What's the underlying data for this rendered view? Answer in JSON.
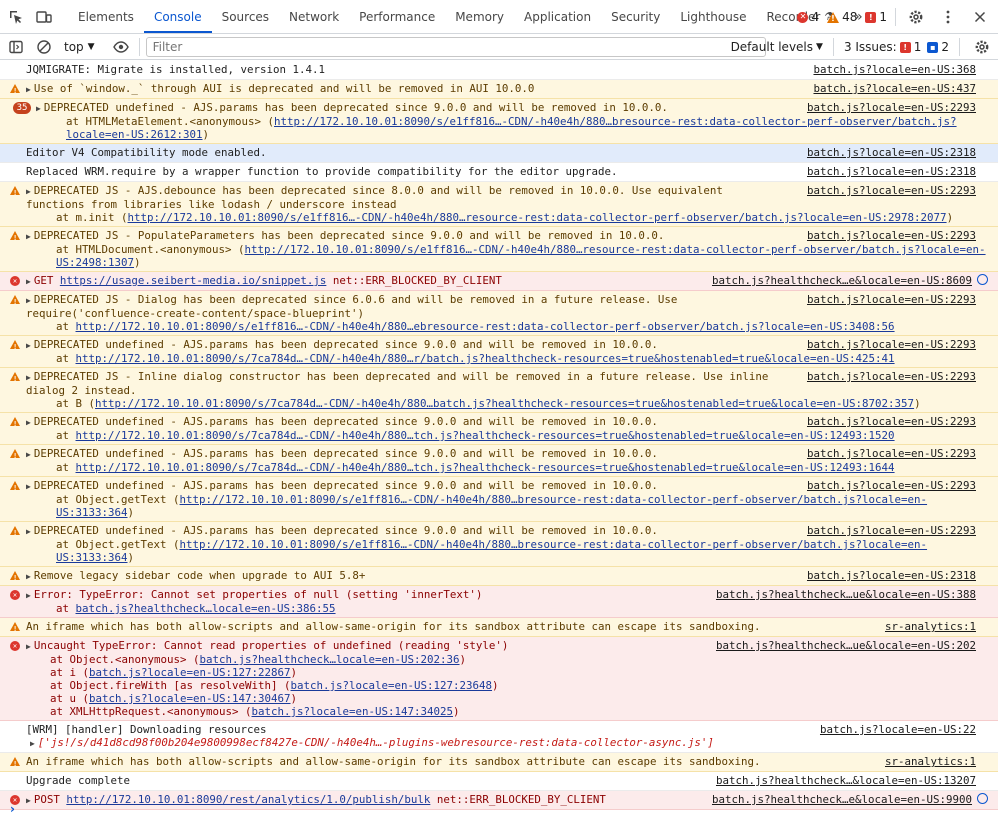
{
  "tabs": [
    "Elements",
    "Console",
    "Sources",
    "Network",
    "Performance",
    "Memory",
    "Application",
    "Security",
    "Lighthouse",
    "Recorder"
  ],
  "active_tab": "Console",
  "counts": {
    "errors": "4",
    "warnings": "48",
    "issues": "1"
  },
  "toolbar": {
    "context": "top",
    "filter_placeholder": "Filter",
    "levels": "Default levels",
    "issues_label": "3 Issues:",
    "issues_err": "1",
    "issues_info": "2"
  },
  "messages": [
    {
      "type": "log",
      "text": "JQMIGRATE: Migrate is installed, version 1.4.1",
      "src": "batch.js?locale=en-US:368"
    },
    {
      "type": "warn",
      "text": "Use of `window._` through AUI is deprecated and will be removed in AUI 10.0.0",
      "src": "batch.js?locale=en-US:437"
    },
    {
      "type": "warn",
      "badge": "35",
      "text": "DEPRECATED undefined - AJS.params has been deprecated since 9.0.0 and will be removed in 10.0.0.",
      "src": "batch.js?locale=en-US:2293",
      "trace": "at HTMLMetaElement.<anonymous> (",
      "link": "http://172.10.10.01:8090/s/e1ff816…-CDN/-h40e4h/880…bresource-rest:data-collector-perf-observer/batch.js?locale=en-US:2612:301",
      ")": ")"
    },
    {
      "type": "info",
      "text": "Editor V4 Compatibility mode enabled.",
      "src": "batch.js?locale=en-US:2318"
    },
    {
      "type": "log",
      "text": "Replaced WRM.require by a wrapper function to provide compatibility for the editor upgrade.",
      "src": "batch.js?locale=en-US:2318"
    },
    {
      "type": "warn",
      "text": "DEPRECATED JS - AJS.debounce has been deprecated since 8.0.0 and will be removed in 10.0.0. Use equivalent functions from libraries like lodash / underscore instead",
      "src": "batch.js?locale=en-US:2293",
      "trace": "at m.init (",
      "link": "http://172.10.10.01:8090/s/e1ff816…-CDN/-h40e4h/880…resource-rest:data-collector-perf-observer/batch.js?locale=en-US:2978:2077"
    },
    {
      "type": "warn",
      "text": "DEPRECATED JS - PopulateParameters has been deprecated since 9.0.0 and will be removed in 10.0.0.",
      "src": "batch.js?locale=en-US:2293",
      "trace": "at HTMLDocument.<anonymous> (",
      "link": "http://172.10.10.01:8090/s/e1ff816…-CDN/-h40e4h/880…resource-rest:data-collector-perf-observer/batch.js?locale=en-US:2498:1307"
    },
    {
      "type": "err",
      "pre": "GET ",
      "link": "https://usage.seibert-media.io/snippet.js",
      "post": " net::ERR_BLOCKED_BY_CLIENT",
      "src": "batch.js?healthcheck…e&locale=en-US:8609"
    },
    {
      "type": "warn",
      "text": "DEPRECATED JS - Dialog has been deprecated since 6.0.6 and will be removed in a future release. Use require('confluence-create-content/space-blueprint')",
      "src": "batch.js?locale=en-US:2293",
      "trace": "at ",
      "link": "http://172.10.10.01:8090/s/e1ff816…-CDN/-h40e4h/880…ebresource-rest:data-collector-perf-observer/batch.js?locale=en-US:3408:56"
    },
    {
      "type": "warn",
      "text": "DEPRECATED undefined - AJS.params has been deprecated since 9.0.0 and will be removed in 10.0.0.",
      "src": "batch.js?locale=en-US:2293",
      "trace": "at ",
      "link": "http://172.10.10.01:8090/s/7ca784d…-CDN/-h40e4h/880…r/batch.js?healthcheck-resources=true&hostenabled=true&locale=en-US:425:41"
    },
    {
      "type": "warn",
      "text": "DEPRECATED JS - Inline dialog constructor has been deprecated and will be removed in a future release. Use inline dialog 2 instead.",
      "src": "batch.js?locale=en-US:2293",
      "trace": "at B (",
      "link": "http://172.10.10.01:8090/s/7ca784d…-CDN/-h40e4h/880…batch.js?healthcheck-resources=true&hostenabled=true&locale=en-US:8702:357"
    },
    {
      "type": "warn",
      "text": "DEPRECATED undefined - AJS.params has been deprecated since 9.0.0 and will be removed in 10.0.0.",
      "src": "batch.js?locale=en-US:2293",
      "trace": "at ",
      "link": "http://172.10.10.01:8090/s/7ca784d…-CDN/-h40e4h/880…tch.js?healthcheck-resources=true&hostenabled=true&locale=en-US:12493:1520"
    },
    {
      "type": "warn",
      "text": "DEPRECATED undefined - AJS.params has been deprecated since 9.0.0 and will be removed in 10.0.0.",
      "src": "batch.js?locale=en-US:2293",
      "trace": "at ",
      "link": "http://172.10.10.01:8090/s/7ca784d…-CDN/-h40e4h/880…tch.js?healthcheck-resources=true&hostenabled=true&locale=en-US:12493:1644"
    },
    {
      "type": "warn",
      "text": "DEPRECATED undefined - AJS.params has been deprecated since 9.0.0 and will be removed in 10.0.0.",
      "src": "batch.js?locale=en-US:2293",
      "trace": "at Object.getText (",
      "link": "http://172.10.10.01:8090/s/e1ff816…-CDN/-h40e4h/880…bresource-rest:data-collector-perf-observer/batch.js?locale=en-US:3133:364"
    },
    {
      "type": "warn",
      "text": "DEPRECATED undefined - AJS.params has been deprecated since 9.0.0 and will be removed in 10.0.0.",
      "src": "batch.js?locale=en-US:2293",
      "trace": "at Object.getText (",
      "link": "http://172.10.10.01:8090/s/e1ff816…-CDN/-h40e4h/880…bresource-rest:data-collector-perf-observer/batch.js?locale=en-US:3133:364"
    },
    {
      "type": "warn",
      "text": "Remove legacy sidebar code when upgrade to AUI 5.8+",
      "src": "batch.js?locale=en-US:2318"
    },
    {
      "type": "err",
      "text": "Error: TypeError: Cannot set properties of null (setting 'innerText')",
      "src": "batch.js?healthcheck…ue&locale=en-US:388",
      "trace": "at ",
      "link": "batch.js?healthcheck…locale=en-US:386:55"
    },
    {
      "type": "warn",
      "text": "An iframe which has both allow-scripts and allow-same-origin for its sandbox attribute can escape its sandboxing.",
      "src": "sr-analytics:1",
      "noarrow": true
    },
    {
      "type": "err",
      "text": "Uncaught TypeError: Cannot read properties of undefined (reading 'style')",
      "src": "batch.js?healthcheck…ue&locale=en-US:202",
      "stack": [
        {
          "pre": "at Object.<anonymous> (",
          "link": "batch.js?healthcheck…locale=en-US:202:36"
        },
        {
          "pre": "at i (",
          "link": "batch.js?locale=en-US:127:22867"
        },
        {
          "pre": "at Object.fireWith [as resolveWith] (",
          "link": "batch.js?locale=en-US:127:23648"
        },
        {
          "pre": "at u (",
          "link": "batch.js?locale=en-US:147:30467"
        },
        {
          "pre": "at XMLHttpRequest.<anonymous> (",
          "link": "batch.js?locale=en-US:147:34025"
        }
      ]
    },
    {
      "type": "log",
      "text": "[WRM] [handler] Downloading resources",
      "src": "batch.js?locale=en-US:22",
      "array": "['js!/s/d41d8cd98f00b204e9800998ecf8427e-CDN/-h40e4h…-plugins-webresource-rest:data-collector-async.js']"
    },
    {
      "type": "warn",
      "text": "An iframe which has both allow-scripts and allow-same-origin for its sandbox attribute can escape its sandboxing.",
      "src": "sr-analytics:1",
      "noarrow": true
    },
    {
      "type": "log",
      "text": "Upgrade complete",
      "src": "batch.js?healthcheck…&locale=en-US:13207"
    },
    {
      "type": "err",
      "pre": "POST ",
      "link": "http://172.10.10.01:8090/rest/analytics/1.0/publish/bulk",
      "post": " net::ERR_BLOCKED_BY_CLIENT",
      "src": "batch.js?healthcheck…e&locale=en-US:9900"
    }
  ],
  "prompt_symbol": "›",
  "colors": {
    "accent": "#0b57d0",
    "warning_bg": "#fef7e0",
    "error_bg": "#fcebeb",
    "info_bg": "#e1ebfb"
  }
}
